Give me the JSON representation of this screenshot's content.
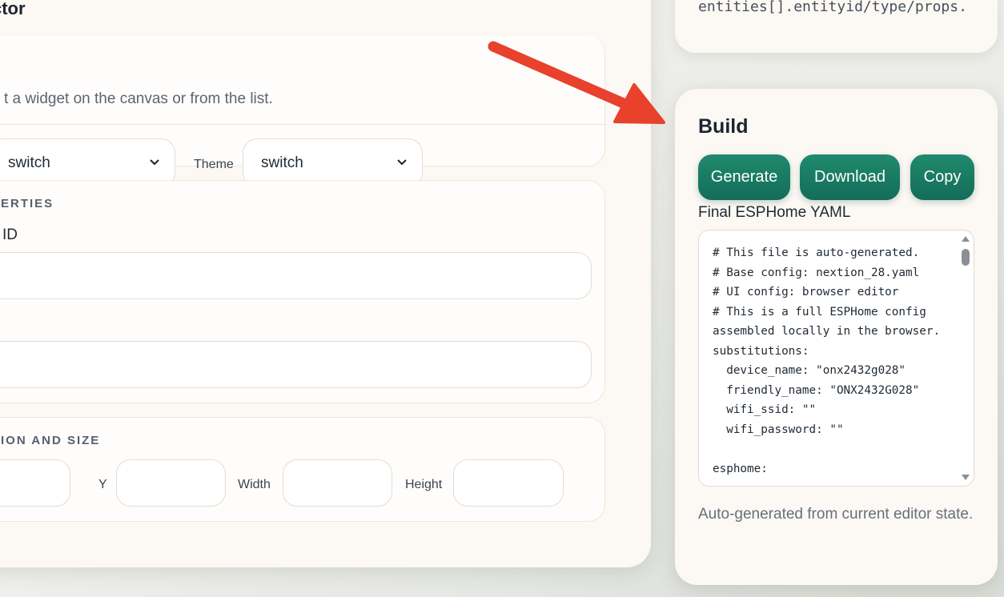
{
  "inspector": {
    "title": "ctor",
    "hint": "t a widget on the canvas or from the list.",
    "widget_select_value": "switch",
    "theme_label": "Theme",
    "theme_select_value": "switch",
    "properties_heading": "ERTIES",
    "id_label": "ID",
    "position_heading": "ION AND SIZE",
    "y_label": "Y",
    "width_label": "Width",
    "height_label": "Height"
  },
  "top_card": {
    "text": "entities[].entityid/type/props."
  },
  "build": {
    "title": "Build",
    "generate_label": "Generate",
    "download_label": "Download",
    "copy_label": "Copy",
    "yaml_label": "Final ESPHome YAML",
    "yaml_content": "# This file is auto-generated.\n# Base config: nextion_28.yaml\n# UI config: browser editor\n# This is a full ESPHome config assembled locally in the browser.\nsubstitutions:\n  device_name: \"onx2432g028\"\n  friendly_name: \"ONX2432G028\"\n  wifi_ssid: \"\"\n  wifi_password: \"\"\n\nesphome:",
    "note": "Auto-generated from current editor state."
  },
  "colors": {
    "accent_button": "#1a7d64",
    "arrow": "#e8412c",
    "panel_bg": "#fcf8f4"
  },
  "icons": {
    "arrow": "red-arrow-annotation",
    "select_chevron": "chevron-down-icon"
  }
}
